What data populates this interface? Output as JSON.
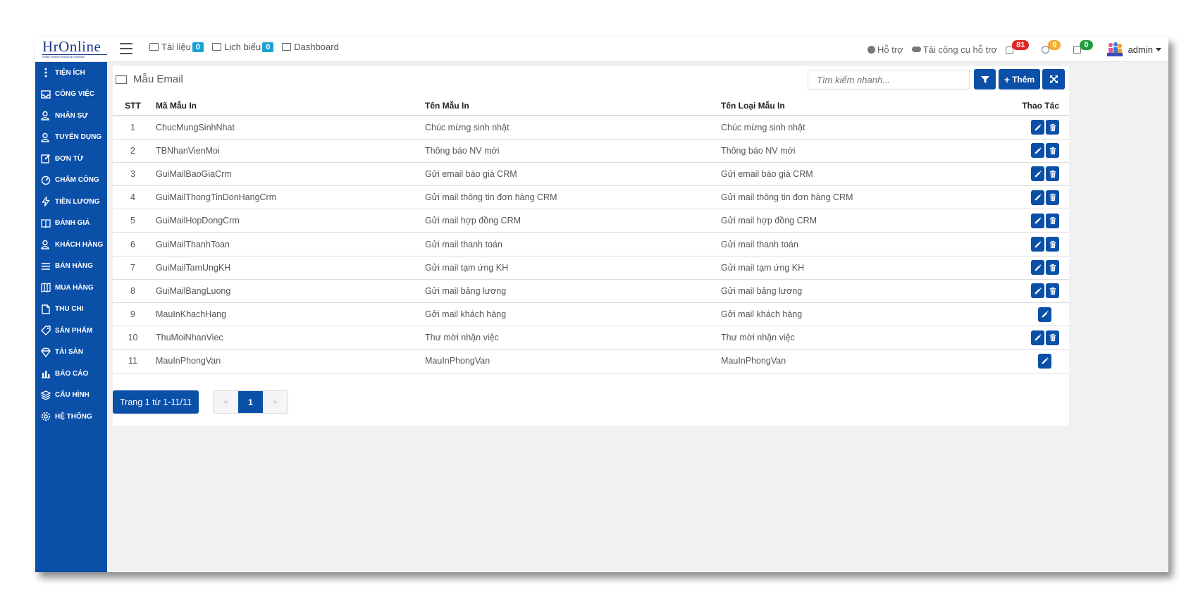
{
  "brand": {
    "logo_text": "HrOnline",
    "logo_subtitle": "Smart Human Resource Software"
  },
  "topnav": [
    {
      "label": "Tài liệu",
      "badge": "0",
      "icon": "folder-icon"
    },
    {
      "label": "Lịch biểu",
      "badge": "0",
      "icon": "calendar-icon"
    },
    {
      "label": "Dashboard",
      "badge": null,
      "icon": "bar-chart-icon"
    }
  ],
  "topright": {
    "support_label": "Hỗ trợ",
    "download_label": "Tải công cụ hỗ trợ",
    "notif_bell": "81",
    "notif_globe": "0",
    "notif_mail": "0",
    "user": "admin"
  },
  "sidebar": {
    "items": [
      {
        "label": "TIỆN ÍCH",
        "icon": "more-vertical-icon"
      },
      {
        "label": "CÔNG VIỆC",
        "icon": "inbox-icon"
      },
      {
        "label": "NHÂN SỰ",
        "icon": "user-icon"
      },
      {
        "label": "TUYỂN DỤNG",
        "icon": "user-icon"
      },
      {
        "label": "ĐƠN TỪ",
        "icon": "edit-icon"
      },
      {
        "label": "CHẤM CÔNG",
        "icon": "gauge-icon"
      },
      {
        "label": "TIỀN LƯƠNG",
        "icon": "bolt-icon"
      },
      {
        "label": "ĐÁNH GIÁ",
        "icon": "book-icon"
      },
      {
        "label": "KHÁCH HÀNG",
        "icon": "user-icon"
      },
      {
        "label": "BÁN HÀNG",
        "icon": "list-icon"
      },
      {
        "label": "MUA HÀNG",
        "icon": "map-icon"
      },
      {
        "label": "THU CHI",
        "icon": "file-icon"
      },
      {
        "label": "SẢN PHẨM",
        "icon": "tag-icon"
      },
      {
        "label": "TÀI SẢN",
        "icon": "diamond-icon"
      },
      {
        "label": "BÁO CÁO",
        "icon": "bar-chart-icon"
      },
      {
        "label": "CẤU HÌNH",
        "icon": "layers-icon"
      },
      {
        "label": "HỆ THỐNG",
        "icon": "gear-icon"
      }
    ]
  },
  "page": {
    "title": "Mẫu Email",
    "search_placeholder": "Tìm kiếm nhanh...",
    "add_label": "Thêm"
  },
  "table": {
    "headers": {
      "stt": "STT",
      "ma": "Mã Mẫu In",
      "ten": "Tên Mẫu In",
      "loai": "Tên Loại Mẫu In",
      "action": "Thao Tác"
    },
    "rows": [
      {
        "stt": "1",
        "ma": "ChucMungSinhNhat",
        "ten": "Chúc mừng sinh nhật",
        "loai": "Chúc mừng sinh nhật",
        "deletable": true
      },
      {
        "stt": "2",
        "ma": "TBNhanVienMoi",
        "ten": "Thông báo NV mới",
        "loai": "Thông báo NV mới",
        "deletable": true
      },
      {
        "stt": "3",
        "ma": "GuiMailBaoGiaCrm",
        "ten": "Gửi email báo giá CRM",
        "loai": "Gửi email báo giá CRM",
        "deletable": true
      },
      {
        "stt": "4",
        "ma": "GuiMailThongTinDonHangCrm",
        "ten": "Gửi mail thông tin đơn hàng CRM",
        "loai": "Gửi mail thông tin đơn hàng CRM",
        "deletable": true
      },
      {
        "stt": "5",
        "ma": "GuiMailHopDongCrm",
        "ten": "Gửi mail hợp đồng CRM",
        "loai": "Gửi mail hợp đồng CRM",
        "deletable": true
      },
      {
        "stt": "6",
        "ma": "GuiMailThanhToan",
        "ten": "Gửi mail thanh toán",
        "loai": "Gửi mail thanh toán",
        "deletable": true
      },
      {
        "stt": "7",
        "ma": "GuiMailTamUngKH",
        "ten": "Gửi mail tạm ứng KH",
        "loai": "Gửi mail tạm ứng KH",
        "deletable": true
      },
      {
        "stt": "8",
        "ma": "GuiMailBangLuong",
        "ten": "Gửi mail bảng lương",
        "loai": "Gửi mail bảng lương",
        "deletable": true
      },
      {
        "stt": "9",
        "ma": "MauInKhachHang",
        "ten": "Gởi mail khách hàng",
        "loai": "Gởi mail khách hàng",
        "deletable": false
      },
      {
        "stt": "10",
        "ma": "ThuMoiNhanViec",
        "ten": "Thư mời nhận việc",
        "loai": "Thư mời nhận việc",
        "deletable": true
      },
      {
        "stt": "11",
        "ma": "MauInPhongVan",
        "ten": "MauInPhongVan",
        "loai": "MauInPhongVan",
        "deletable": false
      }
    ]
  },
  "pagination": {
    "info": "Trang 1 từ 1-11/11",
    "prev": "«",
    "current": "1",
    "next": "»"
  },
  "colors": {
    "primary": "#0a4fa8",
    "badge_blue": "#17a2d8",
    "badge_red": "#e02424",
    "badge_orange": "#f0ad2e",
    "badge_green": "#1e9e3c"
  }
}
